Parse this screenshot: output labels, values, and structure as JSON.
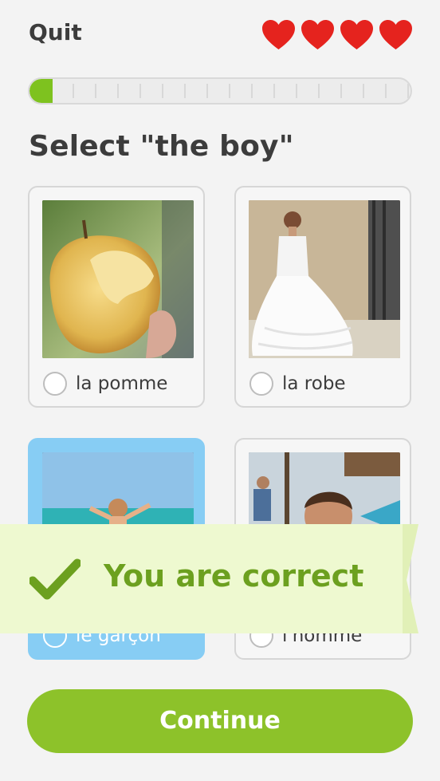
{
  "header": {
    "quit_label": "Quit",
    "hearts": [
      "heart",
      "heart",
      "heart",
      "heart"
    ],
    "heart_color": "#e5231e"
  },
  "progress": {
    "value": 0.06,
    "fill_color": "#7ec21f"
  },
  "prompt": "Select \"the boy\"",
  "choices": [
    {
      "label": "la pomme",
      "image": "bitten apple photo",
      "selected": false
    },
    {
      "label": "la robe",
      "image": "wedding dress photo",
      "selected": false
    },
    {
      "label": "le garçon",
      "image": "boy at beach photo",
      "selected": true
    },
    {
      "label": "l'homme",
      "image": "man photo",
      "selected": false
    }
  ],
  "feedback": {
    "text": "You are correct",
    "icon": "checkmark-icon",
    "text_color": "#6ca01f",
    "banner_color": "#eef9d0"
  },
  "continue_label": "Continue",
  "accent_color": "#8dc22a",
  "selected_color": "#87cdf4"
}
